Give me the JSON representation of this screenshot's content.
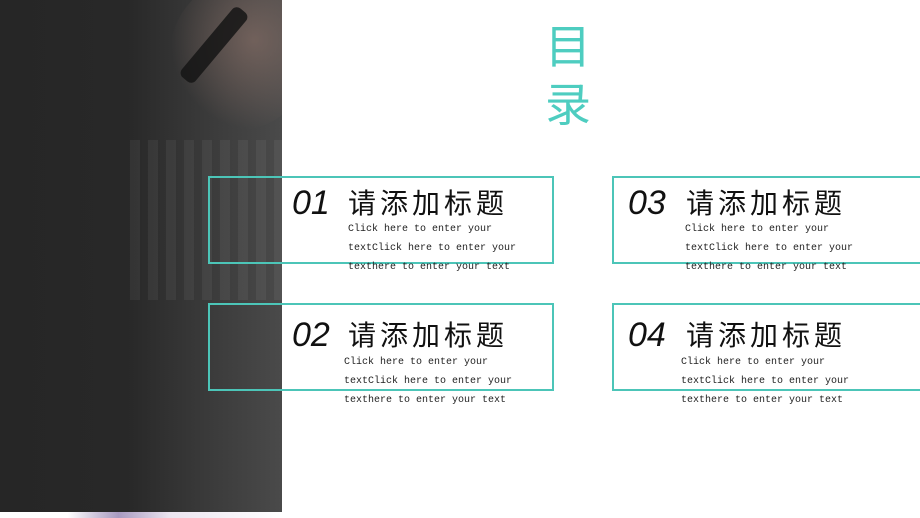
{
  "title": "目\n录",
  "title_chars": [
    "目",
    "录"
  ],
  "accent_color": "#4ecdc0",
  "items": [
    {
      "number": "01",
      "heading": "请添加标题",
      "text": "Click here to enter your textClick here to enter your texthere to enter your text"
    },
    {
      "number": "02",
      "heading": "请添加标题",
      "text": "Click here to enter your textClick here to enter your texthere to enter your text"
    },
    {
      "number": "03",
      "heading": "请添加标题",
      "text": "Click here to enter your textClick here to enter your texthere to enter your text"
    },
    {
      "number": "04",
      "heading": "请添加标题",
      "text": "Click here to enter your textClick here to enter your texthere to enter your text"
    }
  ]
}
